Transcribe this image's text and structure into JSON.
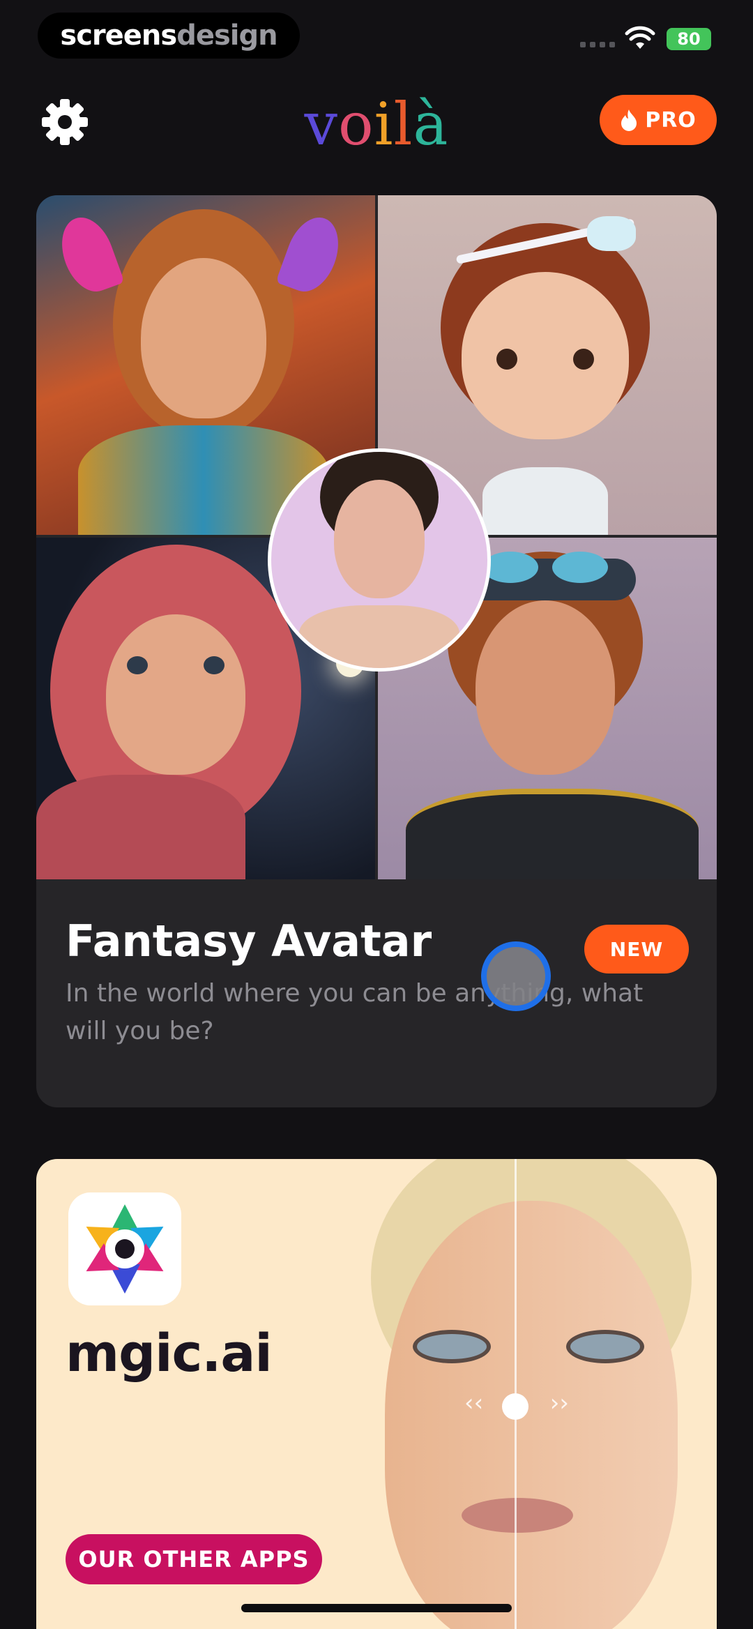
{
  "status_bar": {
    "watermark_part1": "screens",
    "watermark_part2": "design",
    "battery": "80"
  },
  "header": {
    "logo": [
      "v",
      "o",
      "i",
      "l",
      "à"
    ],
    "settings_icon": "gear-icon",
    "pro_label": "PRO",
    "pro_icon": "flame-icon"
  },
  "feature_card": {
    "title": "Fantasy Avatar",
    "subtitle": "In the world where you can be anything, what will you be?",
    "badge": "NEW"
  },
  "promo_card": {
    "app_name": "mgic.ai",
    "button_label": "OUR OTHER APPS",
    "compare_left": "‹‹",
    "compare_right": "››"
  },
  "colors": {
    "background": "#121114",
    "accent_orange": "#ff5a1a",
    "promo_button": "#c81060",
    "promo_bg": "#fde9c9"
  }
}
